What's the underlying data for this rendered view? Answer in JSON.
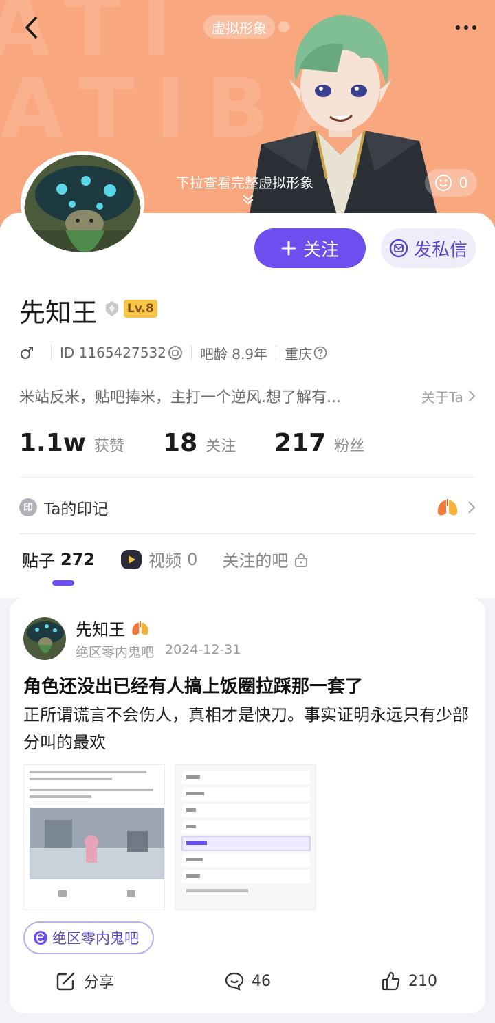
{
  "header": {
    "avatar_tag": "虚拟形象",
    "pull_hint": "下拉查看完整虚拟形象",
    "like_count": "0"
  },
  "profile": {
    "follow_label": "关注",
    "message_label": "发私信",
    "username": "先知王",
    "level": "Lv.8",
    "id_text": "ID 1165427532",
    "bar_age": "吧龄 8.9年",
    "location": "重庆",
    "bio": "米站反米，贴吧捧米，主打一个逆风.想了解有...",
    "about_link": "关于Ta",
    "stats": [
      {
        "num": "1.1w",
        "label": "获赞"
      },
      {
        "num": "18",
        "label": "关注"
      },
      {
        "num": "217",
        "label": "粉丝"
      }
    ],
    "mark_icon": "印",
    "mark_label": "Ta的印记"
  },
  "tabs": [
    {
      "label": "贴子",
      "count": "272"
    },
    {
      "label": "视频",
      "count": "0"
    },
    {
      "label": "关注的吧"
    }
  ],
  "post": {
    "author": "先知王",
    "forum": "绝区零内鬼吧",
    "date": "2024-12-31",
    "title": "角色还没出已经有人搞上饭圈拉踩那一套了",
    "body": "正所谓谎言不会伤人，真相才是快刀。事实证明永远只有少部分叫的最欢",
    "forum_tag": "绝区零内鬼吧",
    "share_label": "分享",
    "comment_count": "46",
    "like_count": "210"
  },
  "colors": {
    "banner": "#f9a77f",
    "accent": "#6d4ff0"
  }
}
